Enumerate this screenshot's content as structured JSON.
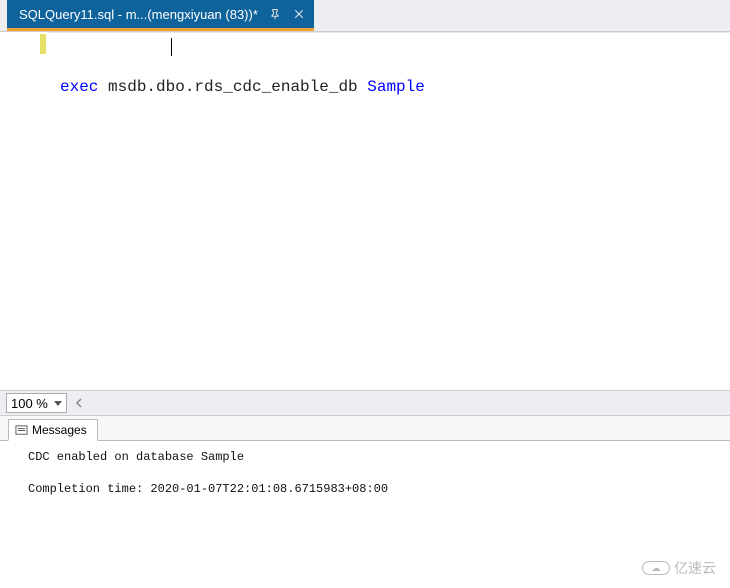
{
  "tab": {
    "title": "SQLQuery11.sql - m...(mengxiyuan (83))*"
  },
  "editor": {
    "line1_keyword": "exec",
    "line1_object": " msdb.dbo.rds_cdc_enable_db ",
    "line1_param": "Sample"
  },
  "zoom": {
    "value": "100 %"
  },
  "resultsTab": {
    "label": "Messages"
  },
  "messages": {
    "line1": "CDC enabled on database Sample",
    "line2": "",
    "line3": "Completion time: 2020-01-07T22:01:08.6715983+08:00"
  },
  "watermark": {
    "text": "亿速云"
  }
}
